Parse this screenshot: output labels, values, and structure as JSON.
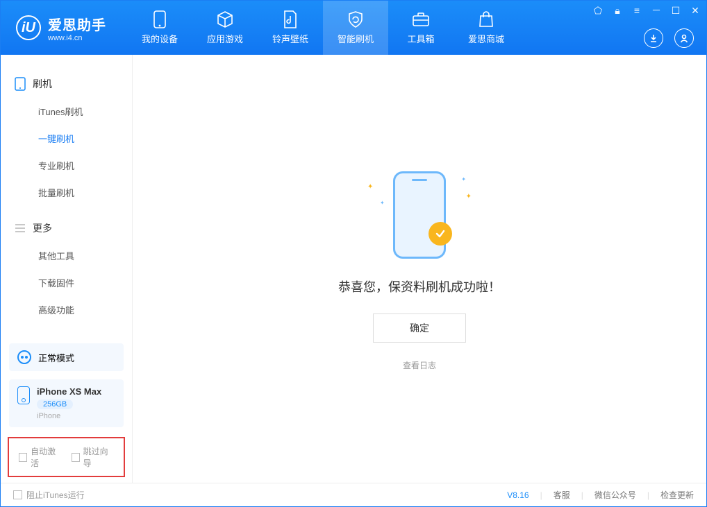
{
  "app": {
    "name_cn": "爱思助手",
    "url": "www.i4.cn",
    "logo_letter": "iU"
  },
  "nav": {
    "items": [
      {
        "label": "我的设备"
      },
      {
        "label": "应用游戏"
      },
      {
        "label": "铃声壁纸"
      },
      {
        "label": "智能刷机"
      },
      {
        "label": "工具箱"
      },
      {
        "label": "爱思商城"
      }
    ]
  },
  "sidebar": {
    "section1": {
      "title": "刷机",
      "items": [
        "iTunes刷机",
        "一键刷机",
        "专业刷机",
        "批量刷机"
      ]
    },
    "section2": {
      "title": "更多",
      "items": [
        "其他工具",
        "下载固件",
        "高级功能"
      ]
    },
    "mode": {
      "label": "正常模式"
    },
    "device": {
      "name": "iPhone XS Max",
      "capacity": "256GB",
      "type": "iPhone"
    },
    "checkboxes": {
      "auto_activate": "自动激活",
      "skip_guide": "跳过向导"
    }
  },
  "main": {
    "success_msg": "恭喜您，保资料刷机成功啦！",
    "ok_btn": "确定",
    "view_log": "查看日志"
  },
  "statusbar": {
    "block_itunes": "阻止iTunes运行",
    "version": "V8.16",
    "links": [
      "客服",
      "微信公众号",
      "检查更新"
    ]
  }
}
